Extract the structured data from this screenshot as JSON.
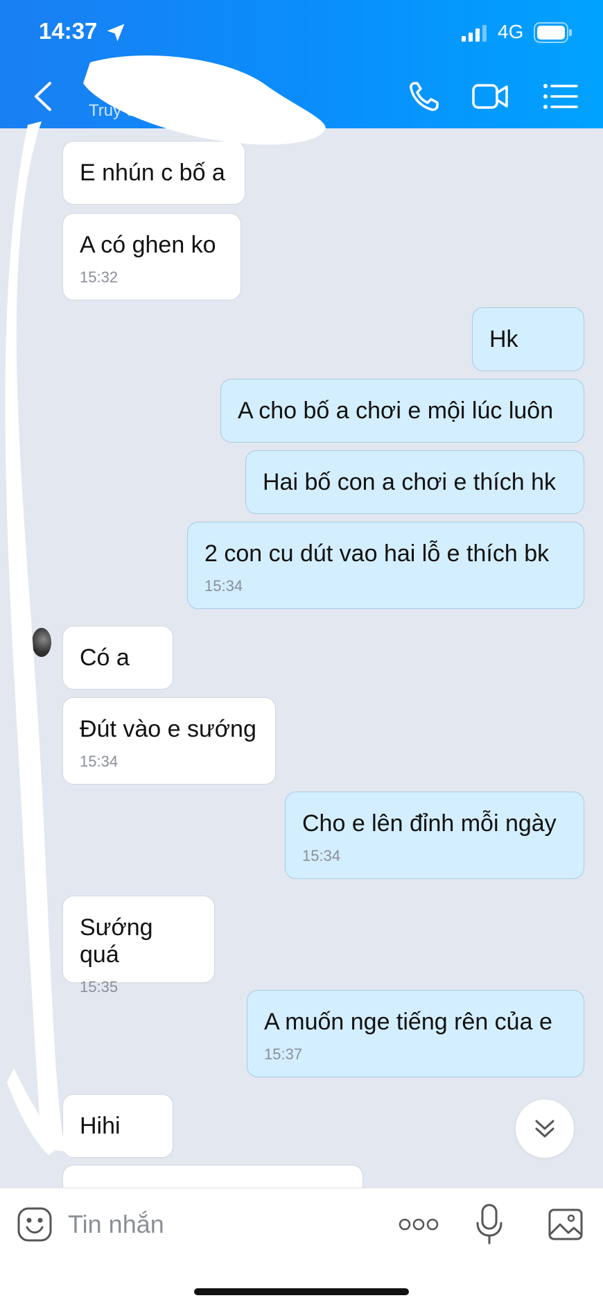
{
  "status_bar": {
    "time": "14:37",
    "network": "4G"
  },
  "header": {
    "subtitle": "Truy cập",
    "accent_color": "#0a8dfb",
    "icons": [
      "back-icon",
      "phone-icon",
      "video-icon",
      "menu-icon"
    ]
  },
  "messages": [
    {
      "dir": "in",
      "text": "E nhún c bố a",
      "time": ""
    },
    {
      "dir": "in",
      "text": "A có ghen ko",
      "time": "15:32"
    },
    {
      "dir": "out",
      "text": "Hk",
      "time": ""
    },
    {
      "dir": "out",
      "text": "A cho bố a chơi e mội lúc luôn",
      "time": ""
    },
    {
      "dir": "out",
      "text": "Hai bố con a chơi e thích hk",
      "time": ""
    },
    {
      "dir": "out",
      "text": "2 con cu dút vao hai lỗ e thích bk",
      "time": "15:34"
    },
    {
      "dir": "in",
      "text": "Có a",
      "time": ""
    },
    {
      "dir": "in",
      "text": "Đút vào e sướng",
      "time": "15:34"
    },
    {
      "dir": "out",
      "text": "Cho e lên đỉnh mỗi ngày",
      "time": "15:34"
    },
    {
      "dir": "in",
      "text": "Sướng quá",
      "time": "15:35"
    },
    {
      "dir": "out",
      "text": "A muốn nge tiếng rên của e",
      "time": "15:37"
    },
    {
      "dir": "in",
      "text": "Hihi",
      "time": ""
    }
  ],
  "input": {
    "placeholder": "Tin nhắn"
  },
  "colors": {
    "incoming_bubble": "#ffffff",
    "outgoing_bubble": "#d3eefe",
    "chat_background": "#e3e7ef"
  }
}
